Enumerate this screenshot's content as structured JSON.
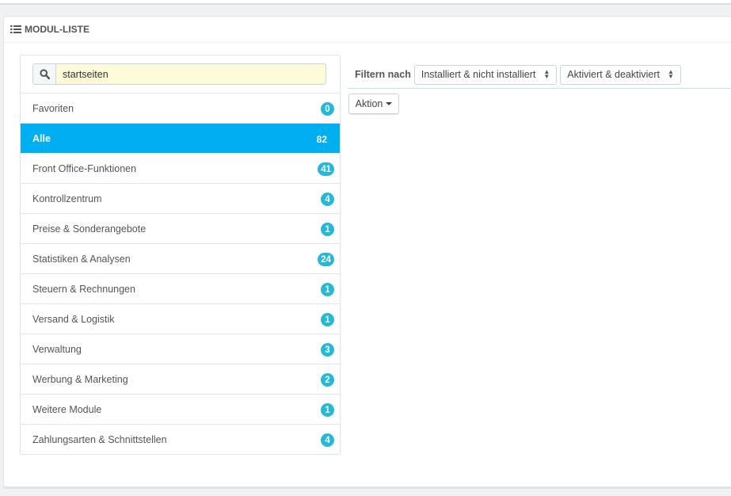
{
  "panel": {
    "title": "MODUL-LISTE",
    "icon": "list-icon"
  },
  "search": {
    "icon": "search-icon",
    "value": "startseiten"
  },
  "categories": [
    {
      "label": "Favoriten",
      "count": "0",
      "active": false
    },
    {
      "label": "Alle",
      "count": "82",
      "active": true
    },
    {
      "label": "Front Office-Funktionen",
      "count": "41",
      "active": false
    },
    {
      "label": "Kontrollzentrum",
      "count": "4",
      "active": false
    },
    {
      "label": "Preise & Sonderangebote",
      "count": "1",
      "active": false
    },
    {
      "label": "Statistiken & Analysen",
      "count": "24",
      "active": false
    },
    {
      "label": "Steuern & Rechnungen",
      "count": "1",
      "active": false
    },
    {
      "label": "Versand & Logistik",
      "count": "1",
      "active": false
    },
    {
      "label": "Verwaltung",
      "count": "3",
      "active": false
    },
    {
      "label": "Werbung & Marketing",
      "count": "2",
      "active": false
    },
    {
      "label": "Weitere Module",
      "count": "1",
      "active": false
    },
    {
      "label": "Zahlungsarten & Schnittstellen",
      "count": "4",
      "active": false
    }
  ],
  "filters": {
    "label": "Filtern nach",
    "install_select": "Installiert & nicht installiert",
    "status_select": "Aktiviert & deaktiviert"
  },
  "action": {
    "label": "Aktion"
  },
  "colors": {
    "active": "#00aff0",
    "badge": "#25b9d7",
    "search_bg": "#fffbd8"
  }
}
